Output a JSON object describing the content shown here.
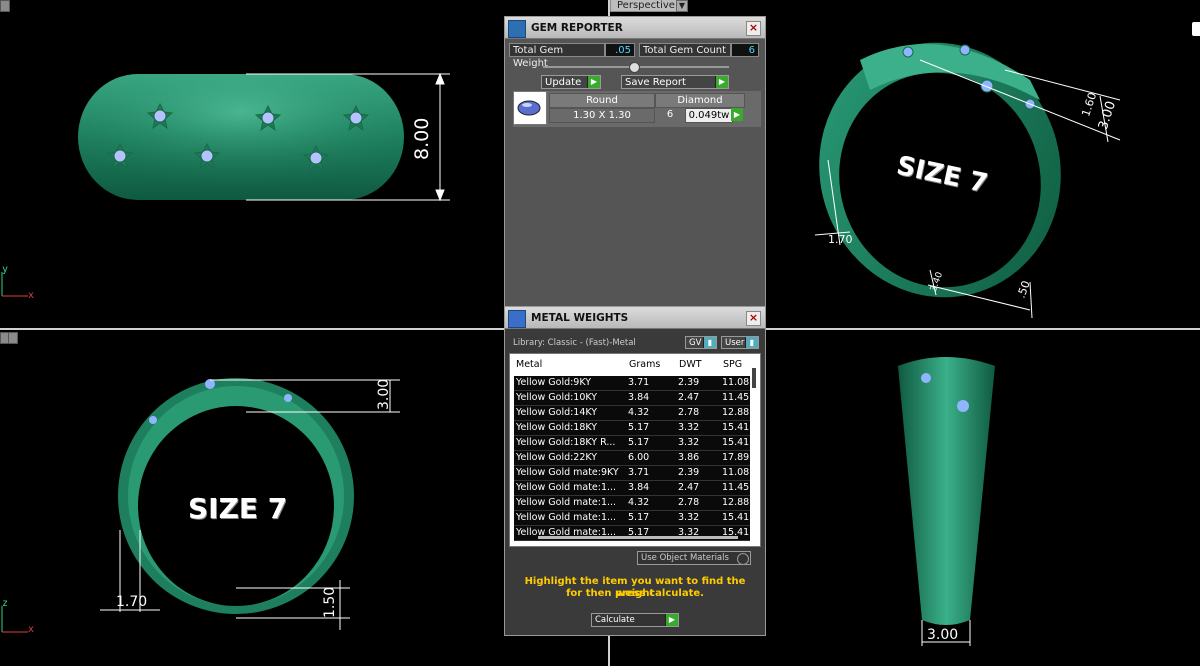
{
  "viewport": {
    "perspective_label": "Perspective",
    "size_label": "SIZE 7",
    "axes": {
      "top_y": "y",
      "top_x": "x",
      "bottom_z": "z",
      "bottom_x": "x"
    },
    "dims": {
      "front_height": "8.00",
      "persp_width": "3.00",
      "persp_top": "1.60",
      "persp_thickness": "1.70",
      "persp_bottom_a": ".50",
      "persp_bottom_b": "3.40",
      "side_top": "3.00",
      "side_thickness": "1.70",
      "side_bottom": "1.50",
      "right_bottom": "3.00"
    },
    "colors": {
      "ring": "#1f8a6a",
      "gem": "#a9b8ff",
      "dim_line": "#ffffff"
    }
  },
  "gem_reporter": {
    "title": "GEM REPORTER",
    "total_weight_label": "Total Gem Weight",
    "total_weight_value": ".05",
    "total_count_label": "Total Gem Count",
    "total_count_value": "6",
    "update_label": "Update",
    "save_label": "Save Report",
    "table": {
      "headers": [
        "Round",
        "Diamond"
      ],
      "size": "1.30 X 1.30",
      "count": "6",
      "weight": "0.049tw"
    }
  },
  "metal_weights": {
    "title": "METAL WEIGHTS",
    "library": "Library: Classic - (Fast)-Metal",
    "gv_label": "GV",
    "user_label": "User",
    "columns": [
      "Metal",
      "Grams",
      "DWT",
      "SPG"
    ],
    "rows": [
      [
        "Yellow Gold:9KY",
        "3.71",
        "2.39",
        "11.08"
      ],
      [
        "Yellow Gold:10KY",
        "3.84",
        "2.47",
        "11.45"
      ],
      [
        "Yellow Gold:14KY",
        "4.32",
        "2.78",
        "12.88"
      ],
      [
        "Yellow Gold:18KY",
        "5.17",
        "3.32",
        "15.41"
      ],
      [
        "Yellow Gold:18KY R...",
        "5.17",
        "3.32",
        "15.41"
      ],
      [
        "Yellow Gold:22KY",
        "6.00",
        "3.86",
        "17.89"
      ],
      [
        "Yellow Gold mate:9KY",
        "3.71",
        "2.39",
        "11.08"
      ],
      [
        "Yellow Gold mate:1...",
        "3.84",
        "2.47",
        "11.45"
      ],
      [
        "Yellow Gold mate:1...",
        "4.32",
        "2.78",
        "12.88"
      ],
      [
        "Yellow Gold mate:1...",
        "5.17",
        "3.32",
        "15.41"
      ],
      [
        "Yellow Gold mate:1...",
        "5.17",
        "3.32",
        "15.41"
      ]
    ],
    "use_object_materials": "Use Object Materials",
    "hint_line1": "Highlight the item you want to find the weight",
    "hint_line2": "for then press calculate.",
    "calculate_label": "Calculate"
  }
}
